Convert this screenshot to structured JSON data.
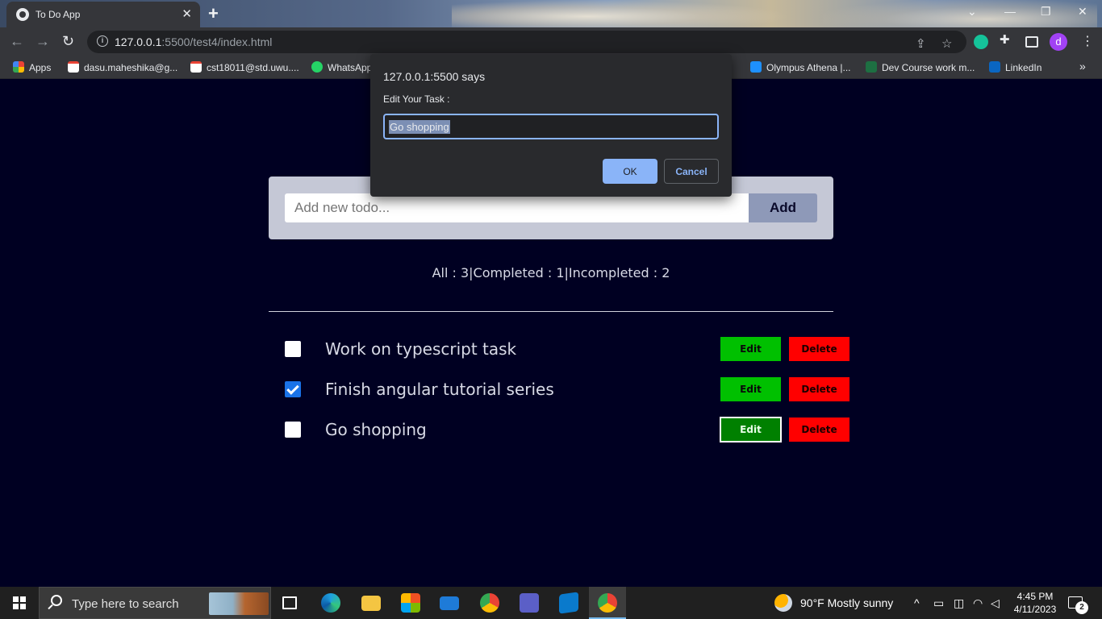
{
  "browser": {
    "tab_title": "To Do App",
    "tab_close": "✕",
    "new_tab": "+",
    "window_controls": [
      "⌄",
      "—",
      "❐",
      "✕"
    ],
    "url_host": "127.0.0.1",
    "url_rest": ":5500/test4/index.html",
    "bookmarks": [
      {
        "label": "Apps",
        "icon": "apps-grid-icon",
        "color": "#e8453c"
      },
      {
        "label": "dasu.maheshika@g...",
        "icon": "gmail-icon",
        "color": "#ea4335"
      },
      {
        "label": "cst18011@std.uwu....",
        "icon": "gmail-icon",
        "color": "#ea4335"
      },
      {
        "label": "WhatsApp",
        "icon": "whatsapp-icon",
        "color": "#25d366"
      },
      {
        "label": "Olympus Athena |...",
        "icon": "olympus-icon",
        "color": "#1e90ff"
      },
      {
        "label": "Dev Course work m...",
        "icon": "excel-icon",
        "color": "#1d6f42"
      },
      {
        "label": "LinkedIn",
        "icon": "linkedin-icon",
        "color": "#0a66c2"
      }
    ],
    "bookmarks_overflow": "»",
    "profile_initial": "d"
  },
  "app": {
    "input_placeholder": "Add new todo...",
    "add_label": "Add",
    "stats": "All : 3|Completed : 1|Incompleted : 2",
    "todos": [
      {
        "text": "Work on typescript task",
        "completed": false
      },
      {
        "text": "Finish angular tutorial series",
        "completed": true
      },
      {
        "text": "Go shopping",
        "completed": false
      }
    ],
    "edit_label": "Edit",
    "delete_label": "Delete"
  },
  "dialog": {
    "origin": "127.0.0.1:5500 says",
    "message": "Edit Your Task :",
    "value": "Go shopping",
    "ok": "OK",
    "cancel": "Cancel"
  },
  "taskbar": {
    "search_placeholder": "Type here to search",
    "weather": "90°F  Mostly sunny",
    "time": "4:45 PM",
    "date": "4/11/2023",
    "notifications": "2"
  },
  "colors": {
    "page_bg": "#000022",
    "edit_green": "#00c000",
    "delete_red": "#ff0000",
    "dialog_accent": "#8ab4f8"
  }
}
